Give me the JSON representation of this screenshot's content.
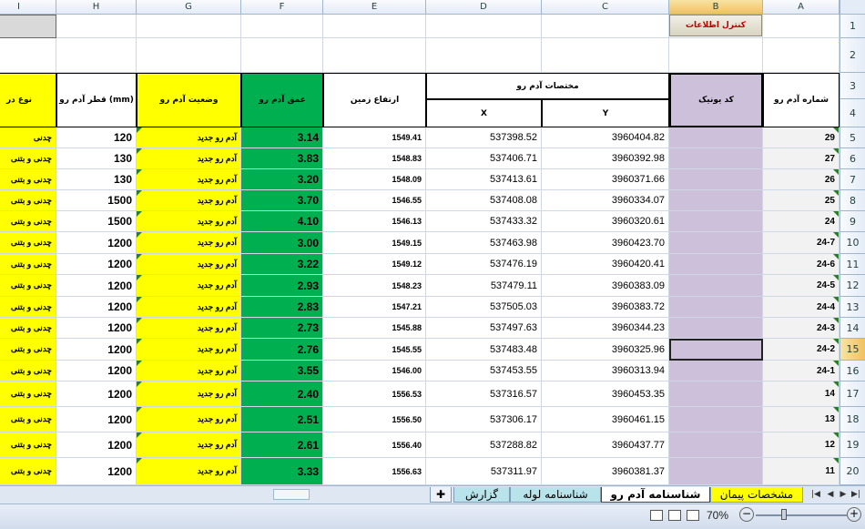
{
  "columns": [
    "A",
    "B",
    "C",
    "D",
    "E",
    "F",
    "G",
    "H",
    "I"
  ],
  "selected_column": "B",
  "selected_row": "15",
  "rows": [
    "1",
    "2",
    "3",
    "4",
    "5",
    "6",
    "7",
    "8",
    "9",
    "10",
    "11",
    "12",
    "13",
    "14",
    "15",
    "16",
    "17",
    "18",
    "19",
    "20"
  ],
  "control_button": "کنترل اطلاعات",
  "headers": {
    "manhole_number": "شماره آدم رو",
    "unique_code": "کد یونیک",
    "coords": "مختصات آدم رو",
    "y": "Y",
    "x": "X",
    "ground_level": "ارتفاع زمین",
    "depth": "عمق آدم رو",
    "status": "وضعیت آدم رو",
    "diameter": "قطر آدم رو (mm)",
    "type": "نوع در"
  },
  "data_rows": [
    {
      "a": "29",
      "y": "3960404.82",
      "x": "537398.52",
      "e": "1549.41",
      "f": "3.14",
      "g": "آدم رو جدید",
      "h": "120",
      "i": "چدنی"
    },
    {
      "a": "27",
      "y": "3960392.98",
      "x": "537406.71",
      "e": "1548.83",
      "f": "3.83",
      "g": "آدم رو جدید",
      "h": "130",
      "i": "چدنی و بتنی"
    },
    {
      "a": "26",
      "y": "3960371.66",
      "x": "537413.61",
      "e": "1548.09",
      "f": "3.20",
      "g": "آدم رو جدید",
      "h": "130",
      "i": "چدنی و بتنی"
    },
    {
      "a": "25",
      "y": "3960334.07",
      "x": "537408.08",
      "e": "1546.55",
      "f": "3.70",
      "g": "آدم رو جدید",
      "h": "1500",
      "i": "چدنی و بتنی"
    },
    {
      "a": "24",
      "y": "3960320.61",
      "x": "537433.32",
      "e": "1546.13",
      "f": "4.10",
      "g": "آدم رو جدید",
      "h": "1500",
      "i": "چدنی و بتنی"
    },
    {
      "a": "24-7",
      "y": "3960423.70",
      "x": "537463.98",
      "e": "1549.15",
      "f": "3.00",
      "g": "آدم رو جدید",
      "h": "1200",
      "i": "چدنی و بتنی"
    },
    {
      "a": "24-6",
      "y": "3960420.41",
      "x": "537476.19",
      "e": "1549.12",
      "f": "3.22",
      "g": "آدم رو جدید",
      "h": "1200",
      "i": "چدنی و بتنی"
    },
    {
      "a": "24-5",
      "y": "3960383.09",
      "x": "537479.11",
      "e": "1548.23",
      "f": "2.93",
      "g": "آدم رو جدید",
      "h": "1200",
      "i": "چدنی و بتنی"
    },
    {
      "a": "24-4",
      "y": "3960383.72",
      "x": "537505.03",
      "e": "1547.21",
      "f": "2.83",
      "g": "آدم رو جدید",
      "h": "1200",
      "i": "چدنی و بتنی"
    },
    {
      "a": "24-3",
      "y": "3960344.23",
      "x": "537497.63",
      "e": "1545.88",
      "f": "2.73",
      "g": "آدم رو جدید",
      "h": "1200",
      "i": "چدنی و بتنی"
    },
    {
      "a": "24-2",
      "y": "3960325.96",
      "x": "537483.48",
      "e": "1545.55",
      "f": "2.76",
      "g": "آدم رو جدید",
      "h": "1200",
      "i": "چدنی و بتنی"
    },
    {
      "a": "24-1",
      "y": "3960313.94",
      "x": "537453.55",
      "e": "1546.00",
      "f": "3.55",
      "g": "آدم رو جدید",
      "h": "1200",
      "i": "چدنی و بتنی"
    },
    {
      "a": "14",
      "y": "3960453.35",
      "x": "537316.57",
      "e": "1556.53",
      "f": "2.40",
      "g": "آدم رو جدید",
      "h": "1200",
      "i": "چدنی و بتنی"
    },
    {
      "a": "13",
      "y": "3960461.15",
      "x": "537306.17",
      "e": "1556.50",
      "f": "2.51",
      "g": "آدم رو جدید",
      "h": "1200",
      "i": "چدنی و بتنی"
    },
    {
      "a": "12",
      "y": "3960437.77",
      "x": "537288.82",
      "e": "1556.40",
      "f": "2.61",
      "g": "آدم رو جدید",
      "h": "1200",
      "i": "چدنی و بتنی"
    },
    {
      "a": "11",
      "y": "3960381.37",
      "x": "537311.97",
      "e": "1556.63",
      "f": "3.33",
      "g": "آدم رو جدید",
      "h": "1200",
      "i": "چدنی و بتنی"
    }
  ],
  "tabs": [
    "مشخصات پیمان",
    "شناسنامه آدم رو",
    "شناسنامه لوله",
    "گزارش"
  ],
  "active_tab": "شناسنامه آدم رو",
  "zoom": "70%",
  "colors": {
    "yellow": "#ffff00",
    "green": "#00b050",
    "lavender": "#ccc0da"
  },
  "icons": [
    "first-sheet-icon",
    "prev-sheet-icon",
    "next-sheet-icon",
    "last-sheet-icon",
    "new-sheet-icon",
    "normal-view-icon",
    "page-layout-icon",
    "page-break-icon",
    "zoom-out-icon",
    "zoom-in-icon"
  ]
}
